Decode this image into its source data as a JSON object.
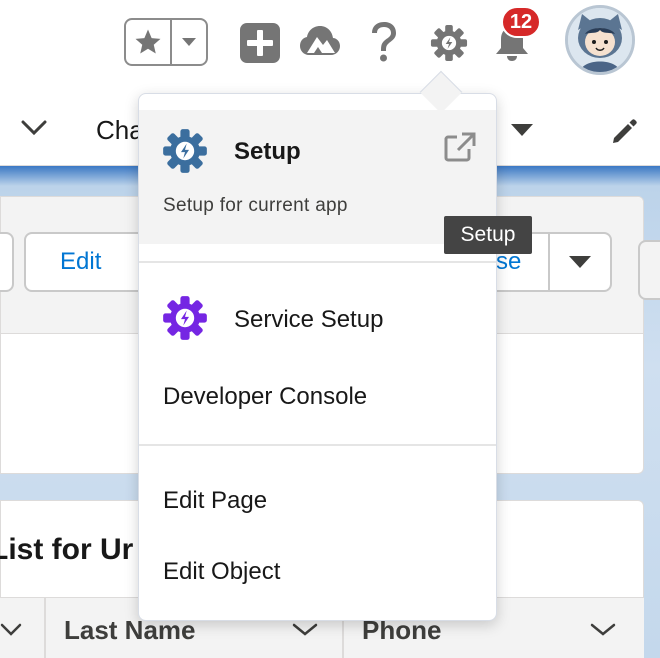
{
  "header": {
    "favorites_star_icon": "star-icon",
    "favorites_caret_icon": "caret-down-icon",
    "global_actions_icon": "plus-icon",
    "trailhead_icon": "trailhead-icon",
    "help_icon": "question-icon",
    "setup_icon": "gear-icon",
    "notifications_icon": "bell-icon",
    "notifications_count": "12",
    "avatar_icon": "astro-avatar-icon"
  },
  "nav": {
    "tab_label": "Cha"
  },
  "record": {
    "edit_button_label": "Edit",
    "partial_button_label": "se"
  },
  "list": {
    "title": "List for Ur",
    "columns": [
      {
        "label": ""
      },
      {
        "label": "Last Name"
      },
      {
        "label": "Phone"
      }
    ]
  },
  "setup_menu": {
    "setup_title": "Setup",
    "setup_subtitle": "Setup for current app",
    "service_setup_label": "Service Setup",
    "developer_console_label": "Developer Console",
    "edit_page_label": "Edit Page",
    "edit_object_label": "Edit Object"
  },
  "tooltip": {
    "text": "Setup"
  },
  "colors": {
    "setup_gear": "#3b6e9e",
    "service_gear": "#7526e3",
    "badge": "#d62929",
    "link": "#0176d3"
  }
}
